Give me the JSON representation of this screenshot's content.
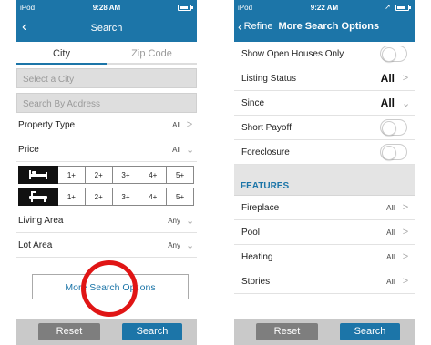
{
  "left": {
    "status": {
      "carrier": "iPod",
      "time": "9:28 AM"
    },
    "nav": {
      "title": "Search"
    },
    "tabs": [
      {
        "label": "City"
      },
      {
        "label": "Zip Code"
      }
    ],
    "city_input": {
      "placeholder": "Select a City"
    },
    "address_input": {
      "placeholder": "Search By Address"
    },
    "property_type": {
      "label": "Property Type",
      "value": "All"
    },
    "price": {
      "label": "Price",
      "value": "All"
    },
    "beds": {
      "icon": "bed-icon",
      "options": [
        "1+",
        "2+",
        "3+",
        "4+",
        "5+"
      ]
    },
    "baths": {
      "icon": "bathtub-icon",
      "options": [
        "1+",
        "2+",
        "3+",
        "4+",
        "5+"
      ]
    },
    "living_area": {
      "label": "Living Area",
      "value": "Any"
    },
    "lot_area": {
      "label": "Lot Area",
      "value": "Any"
    },
    "more_options": {
      "label": "More Search Options"
    },
    "buttons": {
      "reset": "Reset",
      "search": "Search"
    }
  },
  "right": {
    "status": {
      "carrier": "iPod",
      "time": "9:22 AM"
    },
    "nav": {
      "back_label": "Refine",
      "title": "More Search Options"
    },
    "rows": {
      "open_houses": {
        "label": "Show Open Houses Only"
      },
      "listing_status": {
        "label": "Listing Status",
        "value": "All"
      },
      "since": {
        "label": "Since",
        "value": "All"
      },
      "short_payoff": {
        "label": "Short Payoff"
      },
      "foreclosure": {
        "label": "Foreclosure"
      }
    },
    "features": {
      "header": "FEATURES",
      "items": [
        {
          "label": "Fireplace",
          "value": "All"
        },
        {
          "label": "Pool",
          "value": "All"
        },
        {
          "label": "Heating",
          "value": "All"
        },
        {
          "label": "Stories",
          "value": "All"
        }
      ]
    },
    "buttons": {
      "reset": "Reset",
      "search": "Search"
    }
  },
  "colors": {
    "brand_blue": "#1c75a8",
    "highlight_red": "#e01515"
  }
}
